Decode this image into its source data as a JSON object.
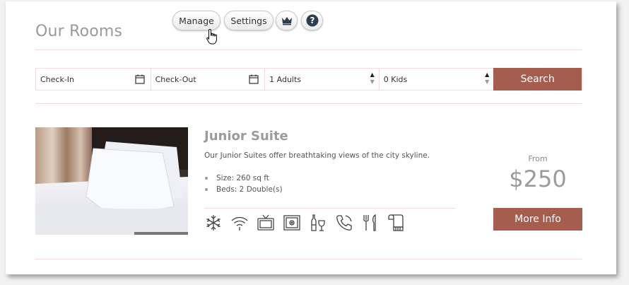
{
  "header": {
    "title": "Our Rooms"
  },
  "toolbar": {
    "manage_label": "Manage",
    "settings_label": "Settings",
    "crown_icon": "crown-icon",
    "help_icon": "help-icon"
  },
  "search": {
    "checkin_placeholder": "Check-In",
    "checkout_placeholder": "Check-Out",
    "adults_value": "1 Adults",
    "kids_value": "0 Kids",
    "button_label": "Search"
  },
  "room": {
    "title": "Junior Suite",
    "description": "Our Junior Suites offer breathtaking views of the city skyline.",
    "features": [
      "Size: 260 sq ft",
      "Beds: 2 Double(s)"
    ],
    "amenities": [
      "snowflake-icon",
      "wifi-icon",
      "tv-icon",
      "safe-icon",
      "wine-icon",
      "phone-icon",
      "restaurant-icon",
      "towel-icon"
    ],
    "from_label": "From",
    "price": "$250",
    "more_info_label": "More Info"
  },
  "colors": {
    "accent": "#a55d4e",
    "divider": "#f0dede",
    "muted_text": "#9b9b9b"
  }
}
